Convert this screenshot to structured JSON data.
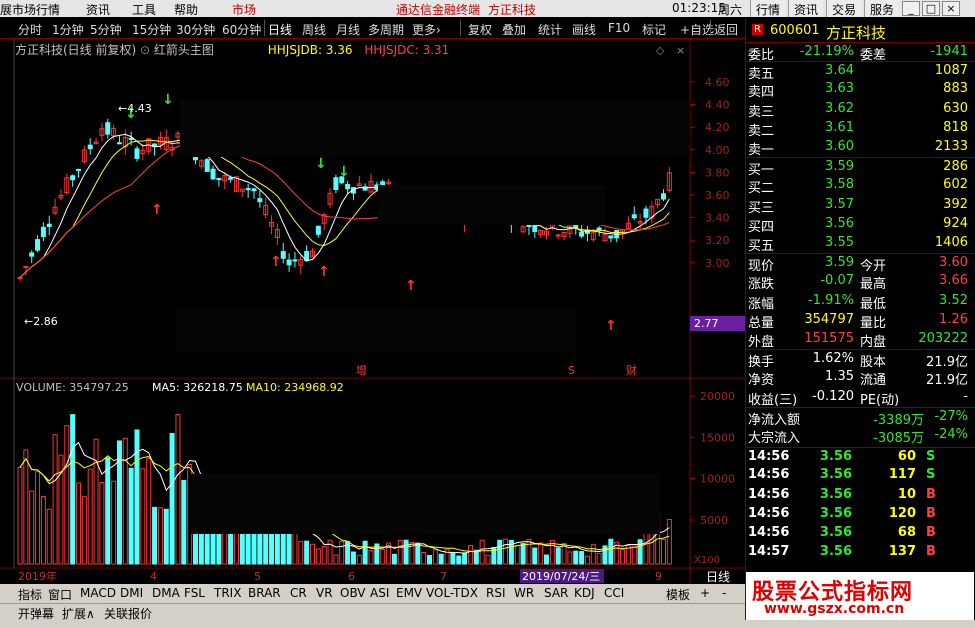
{
  "menu": {
    "items": [
      "展市场行情",
      "资讯",
      "工具",
      "帮助"
    ],
    "active": "市场",
    "center_title": "通达信金融终端",
    "center_stock": "方正科技",
    "time": "01:23:15",
    "weekday": "周六",
    "right_buttons": [
      "行情",
      "资讯",
      "交易",
      "服务"
    ]
  },
  "toolbar": {
    "items": [
      "分时",
      "1分钟",
      "5分钟",
      "15分钟",
      "30分钟",
      "60分钟",
      "日线",
      "周线",
      "月线",
      "多周期",
      "更多›",
      "复权",
      "叠加",
      "统计",
      "画线",
      "F10",
      "标记",
      "+自选",
      "返回"
    ],
    "selected": "日线"
  },
  "chart_header": {
    "name": "方正科技(日线 前复权)",
    "indicator": "红箭头主图",
    "hhjsjdb_label": "HHJSJDB: 3.36",
    "hhjsjdc_label": "HHJSJDC: 3.31"
  },
  "price_axis": {
    "ticks": [
      "4.60",
      "4.40",
      "4.20",
      "4.00",
      "3.80",
      "3.60",
      "3.40",
      "3.20",
      "3.00"
    ]
  },
  "annotations": {
    "high": "4.43",
    "low": "2.86",
    "current_box": "2.77",
    "marker_zeng": "增",
    "marker_s": "S",
    "marker_cai": "财"
  },
  "volume_header": {
    "volume": "VOLUME: 354797.25",
    "ma5": "MA5: 326218.75",
    "ma10": "MA10: 234968.92"
  },
  "volume_axis": {
    "ticks": [
      "20000",
      "15000",
      "10000",
      "5000"
    ],
    "unit": "X100"
  },
  "date_axis": {
    "labels": [
      "2019年",
      "4",
      "5",
      "6",
      "7",
      "2019/07/24/三",
      "9"
    ],
    "right_label": "日线"
  },
  "indicator_tabs": [
    "指标",
    "窗口",
    "MACD",
    "DMI",
    "DMA",
    "FSL",
    "TRIX",
    "BRAR",
    "CR",
    "VR",
    "OBV",
    "ASI",
    "EMV",
    "VOL-TDX",
    "RSI",
    "WR",
    "SAR",
    "KDJ",
    "CCI",
    "模板",
    "+",
    "-"
  ],
  "bottom_links": [
    "开弹幕",
    "扩展∧",
    "关联报价"
  ],
  "quote": {
    "code": "600601",
    "name": "方正科技",
    "badge": "R",
    "weibi_label": "委比",
    "weibi": "-21.19%",
    "weicha_label": "委差",
    "weicha": "-1941",
    "asks": [
      {
        "label": "卖五",
        "price": "3.64",
        "vol": "1087"
      },
      {
        "label": "卖四",
        "price": "3.63",
        "vol": "883"
      },
      {
        "label": "卖三",
        "price": "3.62",
        "vol": "630"
      },
      {
        "label": "卖二",
        "price": "3.61",
        "vol": "818"
      },
      {
        "label": "卖一",
        "price": "3.60",
        "vol": "2133"
      }
    ],
    "bids": [
      {
        "label": "买一",
        "price": "3.59",
        "vol": "286"
      },
      {
        "label": "买二",
        "price": "3.58",
        "vol": "602"
      },
      {
        "label": "买三",
        "price": "3.57",
        "vol": "392"
      },
      {
        "label": "买四",
        "price": "3.56",
        "vol": "924"
      },
      {
        "label": "买五",
        "price": "3.55",
        "vol": "1406"
      }
    ],
    "stats": [
      {
        "l1": "现价",
        "v1": "3.59",
        "l2": "今开",
        "v2": "3.60"
      },
      {
        "l1": "涨跌",
        "v1": "-0.07",
        "l2": "最高",
        "v2": "3.66"
      },
      {
        "l1": "涨幅",
        "v1": "-1.91%",
        "l2": "最低",
        "v2": "3.52"
      },
      {
        "l1": "总量",
        "v1": "354797",
        "l2": "量比",
        "v2": "1.26"
      },
      {
        "l1": "外盘",
        "v1": "151575",
        "l2": "内盘",
        "v2": "203222"
      },
      {
        "l1": "换手",
        "v1": "1.62%",
        "l2": "股本",
        "v2": "21.9亿"
      },
      {
        "l1": "净资",
        "v1": "1.35",
        "l2": "流通",
        "v2": "21.9亿"
      },
      {
        "l1": "收益(三)",
        "v1": "-0.120",
        "l2": "PE(动)",
        "v2": "-"
      }
    ],
    "flows": [
      {
        "label": "净流入额",
        "value": "-3389万",
        "pct": "-27%"
      },
      {
        "label": "大宗流入",
        "value": "-3085万",
        "pct": "-24%"
      }
    ],
    "ticks": [
      {
        "time": "14:56",
        "price": "3.56",
        "vol": "60",
        "side": "S"
      },
      {
        "time": "14:56",
        "price": "3.56",
        "vol": "117",
        "side": "S"
      },
      {
        "time": "14:56",
        "price": "3.56",
        "vol": "10",
        "side": "B"
      },
      {
        "time": "14:56",
        "price": "3.56",
        "vol": "120",
        "side": "B"
      },
      {
        "time": "14:56",
        "price": "3.56",
        "vol": "68",
        "side": "B"
      },
      {
        "time": "14:57",
        "price": "3.56",
        "vol": "137",
        "side": "B"
      }
    ]
  },
  "watermark": {
    "cn": "股票公式指标网",
    "url": "www.gszx.com.cn"
  },
  "colors": {
    "up": "#ff3232",
    "down": "#54ffff",
    "ma5": "#ffffff",
    "ma10": "#ffff00",
    "ma20": "#ff4040",
    "border": "#7a0000"
  }
}
